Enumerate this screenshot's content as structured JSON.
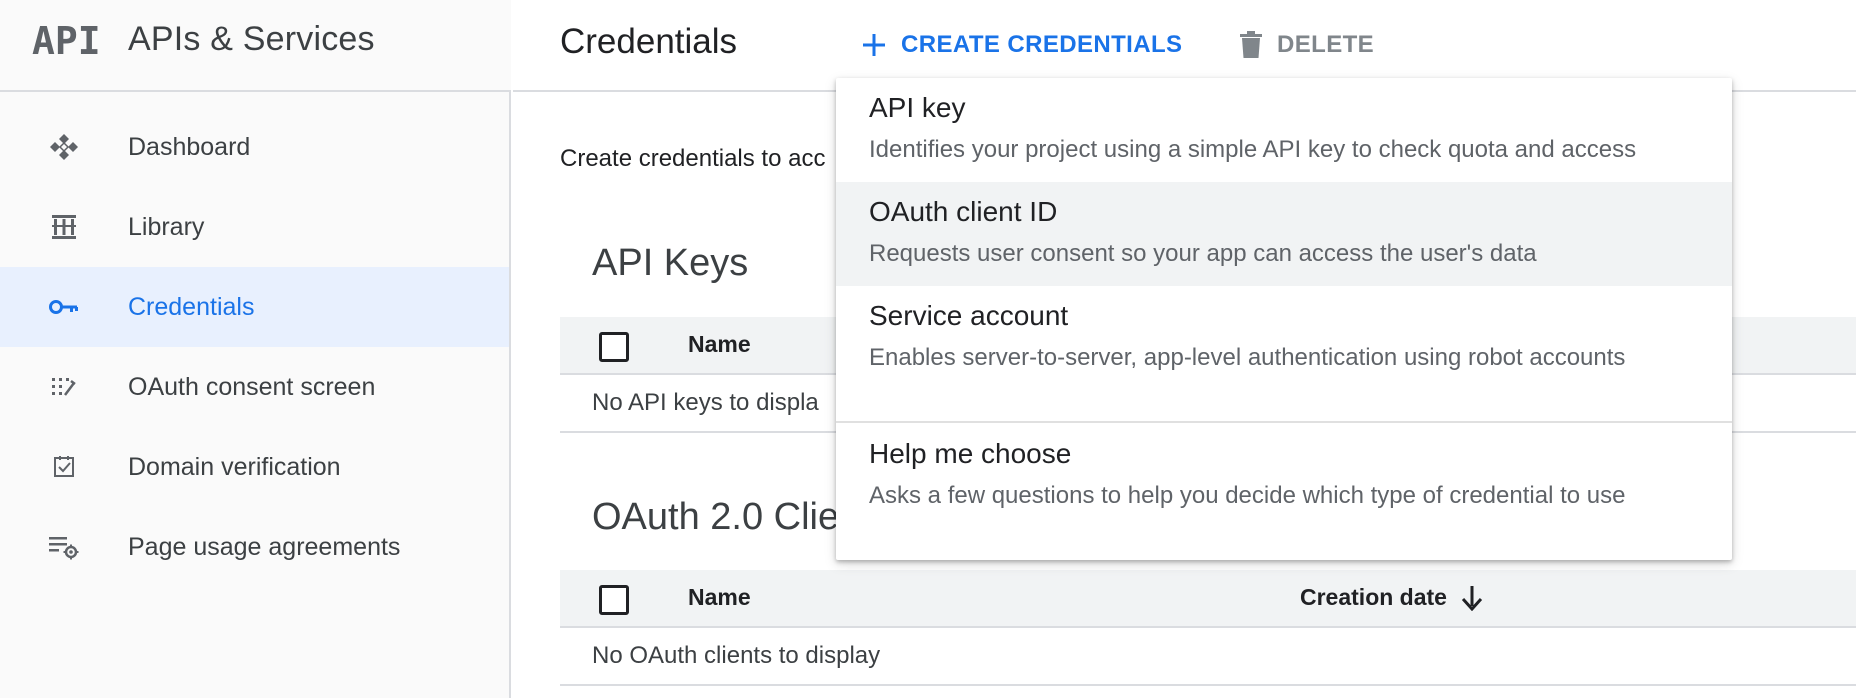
{
  "app": {
    "logo_text": "API",
    "title": "APIs & Services"
  },
  "sidebar": {
    "items": [
      {
        "label": "Dashboard",
        "icon": "dashboard-icon",
        "active": false
      },
      {
        "label": "Library",
        "icon": "library-icon",
        "active": false
      },
      {
        "label": "Credentials",
        "icon": "key-icon",
        "active": true
      },
      {
        "label": "OAuth consent screen",
        "icon": "consent-icon",
        "active": false
      },
      {
        "label": "Domain verification",
        "icon": "checkbox-icon",
        "active": false
      },
      {
        "label": "Page usage agreements",
        "icon": "list-settings-icon",
        "active": false
      }
    ]
  },
  "toolbar": {
    "page_title": "Credentials",
    "create_label": "CREATE CREDENTIALS",
    "delete_label": "DELETE"
  },
  "main": {
    "intro": "Create credentials to acc",
    "api_keys": {
      "title": "API Keys",
      "col_name": "Name",
      "empty": "No API keys to displa"
    },
    "oauth": {
      "title": "OAuth 2.0 Clie",
      "col_name": "Name",
      "col_date": "Creation date",
      "empty": "No OAuth clients to display"
    }
  },
  "menu": {
    "items": [
      {
        "title": "API key",
        "desc": "Identifies your project using a simple API key to check quota and access"
      },
      {
        "title": "OAuth client ID",
        "desc": "Requests user consent so your app can access the user's data"
      },
      {
        "title": "Service account",
        "desc": "Enables server-to-server, app-level authentication using robot accounts"
      },
      {
        "title": "Help me choose",
        "desc": "Asks a few questions to help you decide which type of credential to use"
      }
    ]
  },
  "colors": {
    "accent": "#1a73e8",
    "active_bg": "#e8f0fe",
    "sidebar_bg": "#fafafa",
    "header_row_bg": "#f1f3f4"
  }
}
